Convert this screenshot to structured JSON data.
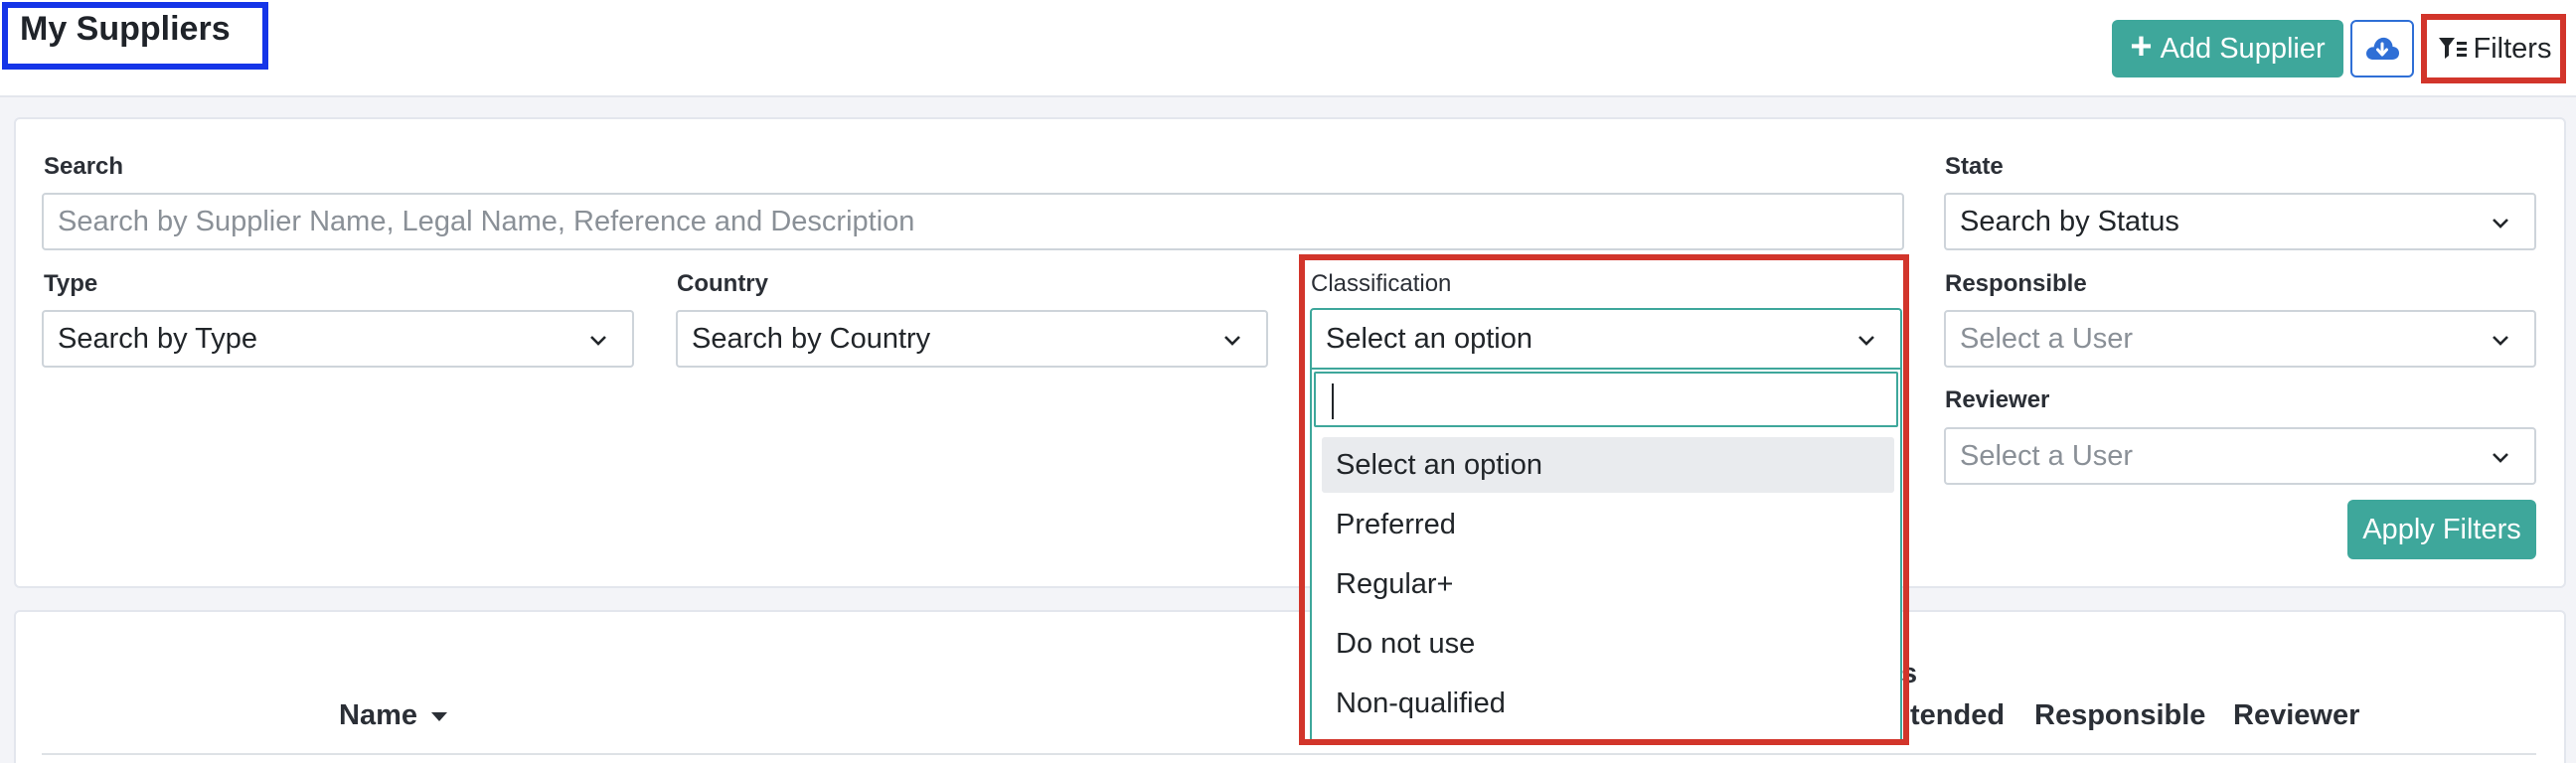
{
  "header": {
    "title": "My Suppliers",
    "add_button": "Add Supplier",
    "download_icon": "cloud-download-icon",
    "filters_button": "Filters",
    "filters_icon": "filter-list-icon"
  },
  "filters": {
    "search": {
      "label": "Search",
      "placeholder": "Search by Supplier Name, Legal Name, Reference and Description"
    },
    "state": {
      "label": "State",
      "value": "Search by Status"
    },
    "type": {
      "label": "Type",
      "value": "Search by Type"
    },
    "country": {
      "label": "Country",
      "value": "Search by Country"
    },
    "classification": {
      "label": "Classification",
      "value": "Select an option",
      "search_value": "",
      "options": [
        "Select an option",
        "Preferred",
        "Regular+",
        "Do not use",
        "Non-qualified"
      ],
      "highlighted_index": 0
    },
    "responsible": {
      "label": "Responsible",
      "placeholder": "Select a User"
    },
    "reviewer": {
      "label": "Reviewer",
      "placeholder": "Select a User"
    },
    "apply_button": "Apply Filters"
  },
  "table": {
    "columns": [
      {
        "label": "Name",
        "sorted": "desc"
      },
      {
        "label": "s"
      },
      {
        "label": "tended"
      },
      {
        "label": "Responsible"
      },
      {
        "label": "Reviewer"
      }
    ]
  },
  "colors": {
    "primary": "#3ea79b",
    "title_highlight": "#1535e8",
    "annotation_highlight": "#d2352b",
    "download_border": "#2f6fd6"
  }
}
